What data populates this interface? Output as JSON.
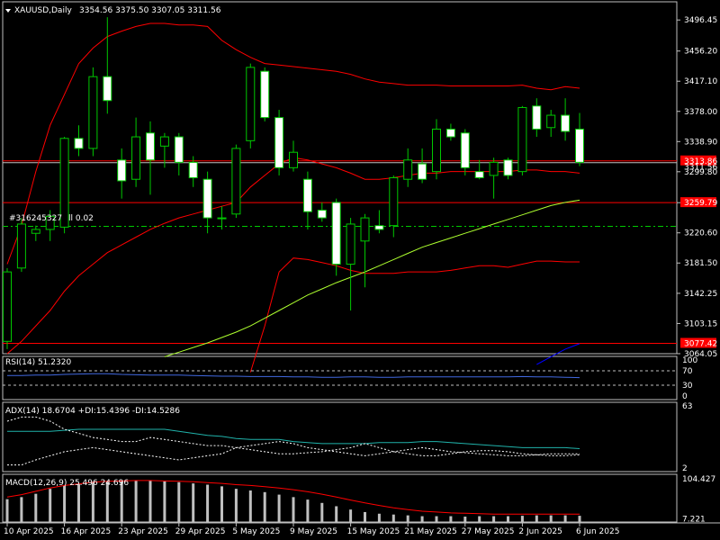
{
  "colors": {
    "background": "#000000",
    "grid": "#ffffff",
    "candle_up": "#00c800",
    "candle_down_body": "#ffffff",
    "bollinger": "#ff0000",
    "ma_light": "#adff2f",
    "rsi_line": "#4169e1",
    "adx_main": "#20b2aa",
    "macd_hist": "#c0c0c0",
    "macd_signal": "#ff0000",
    "price_tag": "#ff0000"
  },
  "chart_data": [
    {
      "type": "candlestick",
      "title": "XAUUSD,Daily",
      "ohlc_readout": "3354.56 3375.50 3307.05 3311.56",
      "aux_label_1": "#316245327",
      "aux_label_2": "ll 0.02",
      "ylim": [
        3064,
        3520
      ],
      "y_ticks": [
        "3496.45",
        "3456.20",
        "3417.10",
        "3378.00",
        "3338.90",
        "3299.80",
        "3259.70",
        "3220.60",
        "3181.50",
        "3142.25",
        "3103.15",
        "3064.05"
      ],
      "y_tick_values": [
        3496.45,
        3456.2,
        3417.1,
        3378.0,
        3338.9,
        3299.8,
        3259.7,
        3220.6,
        3181.5,
        3142.25,
        3103.15,
        3064.05
      ],
      "price_tags": [
        {
          "label": "3313.86",
          "value": 3313.86
        },
        {
          "label": "3311.56",
          "value": 3311.56
        },
        {
          "label": "3259.79",
          "value": 3259.79
        },
        {
          "label": "3077.42",
          "value": 3077.42
        }
      ],
      "hlines": [
        {
          "value": 3313.86,
          "color": "#ff0000",
          "style": "solid"
        },
        {
          "value": 3311.56,
          "color": "#c0c0c0",
          "style": "solid"
        },
        {
          "value": 3259.79,
          "color": "#ff0000",
          "style": "solid"
        },
        {
          "value": 3077.42,
          "color": "#ff0000",
          "style": "solid"
        },
        {
          "value": 3229.0,
          "color": "#00c800",
          "style": "dashed"
        }
      ],
      "x_labels": [
        "10 Apr 2025",
        "16 Apr 2025",
        "23 Apr 2025",
        "29 Apr 2025",
        "5 May 2025",
        "9 May 2025",
        "15 May 2025",
        "21 May 2025",
        "27 May 2025",
        "2 Jun 2025",
        "6 Jun 2025"
      ],
      "x_label_index": [
        0,
        4,
        8,
        12,
        16,
        20,
        24,
        28,
        32,
        36,
        40
      ],
      "candles": [
        {
          "o": 3080,
          "h": 3175,
          "l": 3070,
          "c": 3170
        },
        {
          "o": 3175,
          "h": 3240,
          "l": 3170,
          "c": 3232
        },
        {
          "o": 3220,
          "h": 3230,
          "l": 3210,
          "c": 3225
        },
        {
          "o": 3225,
          "h": 3250,
          "l": 3210,
          "c": 3242
        },
        {
          "o": 3228,
          "h": 3345,
          "l": 3220,
          "c": 3343
        },
        {
          "o": 3343,
          "h": 3360,
          "l": 3320,
          "c": 3330
        },
        {
          "o": 3330,
          "h": 3435,
          "l": 3320,
          "c": 3423
        },
        {
          "o": 3423,
          "h": 3500,
          "l": 3375,
          "c": 3392
        },
        {
          "o": 3315,
          "h": 3330,
          "l": 3265,
          "c": 3288
        },
        {
          "o": 3290,
          "h": 3370,
          "l": 3280,
          "c": 3345
        },
        {
          "o": 3350,
          "h": 3365,
          "l": 3270,
          "c": 3315
        },
        {
          "o": 3333,
          "h": 3350,
          "l": 3305,
          "c": 3345
        },
        {
          "o": 3345,
          "h": 3350,
          "l": 3295,
          "c": 3312
        },
        {
          "o": 3312,
          "h": 3320,
          "l": 3280,
          "c": 3292
        },
        {
          "o": 3290,
          "h": 3300,
          "l": 3220,
          "c": 3240
        },
        {
          "o": 3240,
          "h": 3255,
          "l": 3225,
          "c": 3240
        },
        {
          "o": 3245,
          "h": 3335,
          "l": 3240,
          "c": 3330
        },
        {
          "o": 3340,
          "h": 3440,
          "l": 3330,
          "c": 3435
        },
        {
          "o": 3430,
          "h": 3435,
          "l": 3365,
          "c": 3370
        },
        {
          "o": 3370,
          "h": 3380,
          "l": 3295,
          "c": 3305
        },
        {
          "o": 3305,
          "h": 3340,
          "l": 3300,
          "c": 3325
        },
        {
          "o": 3290,
          "h": 3300,
          "l": 3225,
          "c": 3248
        },
        {
          "o": 3250,
          "h": 3260,
          "l": 3235,
          "c": 3240
        },
        {
          "o": 3260,
          "h": 3265,
          "l": 3165,
          "c": 3180
        },
        {
          "o": 3180,
          "h": 3240,
          "l": 3120,
          "c": 3232
        },
        {
          "o": 3210,
          "h": 3245,
          "l": 3150,
          "c": 3240
        },
        {
          "o": 3230,
          "h": 3250,
          "l": 3220,
          "c": 3225
        },
        {
          "o": 3230,
          "h": 3295,
          "l": 3215,
          "c": 3292
        },
        {
          "o": 3290,
          "h": 3330,
          "l": 3280,
          "c": 3315
        },
        {
          "o": 3310,
          "h": 3330,
          "l": 3285,
          "c": 3290
        },
        {
          "o": 3300,
          "h": 3368,
          "l": 3290,
          "c": 3355
        },
        {
          "o": 3355,
          "h": 3362,
          "l": 3340,
          "c": 3345
        },
        {
          "o": 3350,
          "h": 3355,
          "l": 3295,
          "c": 3305
        },
        {
          "o": 3300,
          "h": 3315,
          "l": 3290,
          "c": 3292
        },
        {
          "o": 3295,
          "h": 3318,
          "l": 3265,
          "c": 3312
        },
        {
          "o": 3315,
          "h": 3318,
          "l": 3290,
          "c": 3295
        },
        {
          "o": 3300,
          "h": 3385,
          "l": 3295,
          "c": 3383
        },
        {
          "o": 3385,
          "h": 3395,
          "l": 3345,
          "c": 3355
        },
        {
          "o": 3357,
          "h": 3380,
          "l": 3345,
          "c": 3373
        },
        {
          "o": 3373,
          "h": 3395,
          "l": 3340,
          "c": 3352
        },
        {
          "o": 3355,
          "h": 3376,
          "l": 3307,
          "c": 3312
        }
      ],
      "bb_upper": [
        3180,
        3230,
        3300,
        3360,
        3400,
        3440,
        3460,
        3475,
        3482,
        3488,
        3492,
        3492,
        3490,
        3490,
        3488,
        3470,
        3458,
        3448,
        3440,
        3438,
        3436,
        3434,
        3432,
        3430,
        3426,
        3420,
        3416,
        3414,
        3412,
        3412,
        3412,
        3411,
        3411,
        3411,
        3411,
        3411,
        3412,
        3408,
        3406,
        3410,
        3408
      ],
      "bb_mid": [
        3064,
        3080,
        3100,
        3120,
        3145,
        3165,
        3180,
        3195,
        3205,
        3215,
        3225,
        3233,
        3240,
        3245,
        3250,
        3255,
        3260,
        3280,
        3295,
        3310,
        3318,
        3315,
        3310,
        3305,
        3298,
        3290,
        3290,
        3292,
        3295,
        3298,
        3298,
        3300,
        3300,
        3300,
        3300,
        3300,
        3302,
        3302,
        3300,
        3300,
        3298
      ],
      "bb_lower": [
        null,
        null,
        null,
        null,
        null,
        null,
        null,
        null,
        null,
        null,
        null,
        null,
        null,
        null,
        null,
        null,
        null,
        3040,
        3100,
        3170,
        3188,
        3186,
        3182,
        3178,
        3172,
        3168,
        3168,
        3168,
        3170,
        3170,
        3170,
        3172,
        3175,
        3178,
        3178,
        3176,
        3180,
        3184,
        3184,
        3183,
        3183
      ],
      "ma_long": [
        null,
        null,
        null,
        null,
        null,
        null,
        null,
        null,
        null,
        null,
        null,
        3060,
        3066,
        3072,
        3078,
        3085,
        3092,
        3100,
        3110,
        3120,
        3130,
        3140,
        3148,
        3156,
        3163,
        3170,
        3178,
        3186,
        3194,
        3202,
        3208,
        3214,
        3220,
        3226,
        3232,
        3238,
        3244,
        3250,
        3256,
        3260,
        3263
      ],
      "ma_blue_tail": [
        null,
        null,
        null,
        null,
        null,
        null,
        null,
        null,
        null,
        null,
        null,
        null,
        null,
        null,
        null,
        null,
        null,
        null,
        null,
        null,
        null,
        null,
        null,
        null,
        null,
        null,
        null,
        null,
        null,
        null,
        null,
        null,
        null,
        null,
        null,
        null,
        null,
        3050,
        3060,
        3070,
        3077
      ]
    },
    {
      "type": "line",
      "title": "RSI(14) 51.2320",
      "ylim": [
        0,
        100
      ],
      "y_ticks": [
        "100",
        "70",
        "30",
        "0"
      ],
      "y_tick_values": [
        100,
        70,
        30,
        0
      ],
      "levels": [
        70,
        30
      ],
      "values": [
        57,
        57,
        58,
        58,
        60,
        61,
        62,
        62,
        60,
        59,
        58,
        58,
        58,
        57,
        56,
        55,
        55,
        54,
        54,
        54,
        53,
        53,
        52,
        52,
        53,
        53,
        52,
        52,
        53,
        53,
        53,
        53,
        53,
        53,
        53,
        53,
        54,
        53,
        53,
        52,
        51
      ]
    },
    {
      "type": "line",
      "title": "ADX(14) 18.6704 +DI:15.4396 -DI:14.5286",
      "ylim": [
        2,
        63
      ],
      "y_ticks": [
        "63",
        "2"
      ],
      "y_tick_values": [
        63,
        2
      ],
      "series": [
        {
          "values": [
            38,
            38,
            38,
            38,
            39,
            40,
            40,
            40,
            40,
            40,
            40,
            40,
            38,
            36,
            34,
            33,
            31,
            30,
            30,
            30,
            28,
            27,
            26,
            26,
            26,
            26,
            27,
            27,
            27,
            28,
            28,
            27,
            26,
            25,
            24,
            23,
            22,
            22,
            22,
            22,
            21
          ]
        },
        {
          "values": [
            48,
            52,
            52,
            48,
            40,
            36,
            32,
            30,
            28,
            28,
            32,
            30,
            28,
            26,
            24,
            24,
            22,
            20,
            18,
            16,
            16,
            17,
            18,
            20,
            22,
            26,
            22,
            18,
            16,
            14,
            14,
            16,
            18,
            19,
            19,
            18,
            16,
            15,
            14,
            14,
            15
          ]
        },
        {
          "values": [
            5,
            5,
            10,
            14,
            18,
            20,
            22,
            20,
            18,
            16,
            14,
            12,
            10,
            12,
            14,
            16,
            22,
            24,
            26,
            28,
            26,
            22,
            20,
            18,
            16,
            14,
            16,
            18,
            20,
            22,
            20,
            18,
            17,
            16,
            15,
            14,
            14,
            15,
            16,
            16,
            16
          ]
        }
      ]
    },
    {
      "type": "bar",
      "title": "MACD(12,26,9) 25.496 24.696",
      "ylim": [
        0,
        115
      ],
      "y_ticks": [
        "104.427",
        "7.221"
      ],
      "y_tick_values": [
        104.427,
        7.221
      ],
      "values": [
        55,
        60,
        68,
        80,
        88,
        92,
        96,
        98,
        100,
        100,
        100,
        98,
        96,
        93,
        90,
        86,
        80,
        76,
        72,
        66,
        60,
        54,
        46,
        38,
        30,
        24,
        20,
        18,
        16,
        14,
        14,
        14,
        13,
        14,
        14,
        14,
        15,
        16,
        16,
        16,
        15
      ],
      "signal": [
        60,
        66,
        74,
        82,
        88,
        92,
        96,
        98,
        99,
        100,
        100,
        99,
        98,
        97,
        95,
        93,
        90,
        88,
        85,
        82,
        78,
        73,
        67,
        60,
        53,
        46,
        40,
        34,
        30,
        26,
        24,
        22,
        21,
        20,
        19,
        19,
        19,
        19,
        19,
        19,
        19
      ]
    }
  ]
}
